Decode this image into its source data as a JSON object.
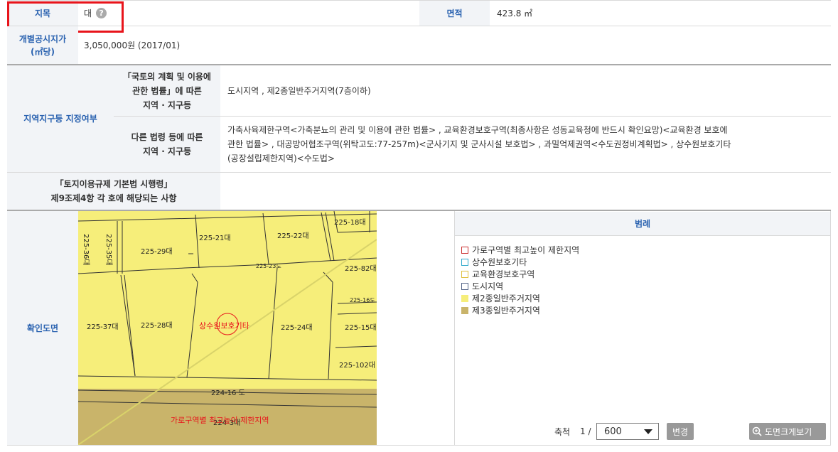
{
  "rows": {
    "jimok": {
      "label": "지목",
      "value": "대"
    },
    "area": {
      "label": "면적",
      "value": "423.8 ㎡"
    },
    "price": {
      "label_line1": "개별공시지가",
      "label_line2": "(㎡당)",
      "value": "3,050,000원 (2017/01)"
    },
    "zone": {
      "label": "지역지구등 지정여부",
      "national": {
        "label_line1": "「국토의 계획 및 이용에",
        "label_line2": "관한 법률」에 따른",
        "label_line3": "지역 · 지구등",
        "value": "도시지역 , 제2종일반주거지역(7층이하)"
      },
      "other": {
        "label_line1": "다른 법령 등에 따른",
        "label_line2": "지역 · 지구등",
        "value_line1": "가축사육제한구역<가축분뇨의 관리 및 이용에 관한 법률> , 교육환경보호구역(최종사항은 성동교육청에 반드시 확인요망)<교육환경 보호에",
        "value_line2": "관한 법률> , 대공방어협조구역(위탁고도:77-257m)<군사기지 및 군사시설 보호법> , 과밀억제권역<수도권정비계획법> , 상수원보호기타",
        "value_line3": "(공장설립제한지역)<수도법>"
      }
    },
    "enforce": {
      "label_line1": "「토지이용규제 기본법 시행령」",
      "label_line2": "제9조제4항 각 호에 해당되는 사항",
      "value": ""
    },
    "map": {
      "label": "확인도면"
    }
  },
  "map": {
    "parcels": [
      "225-18대",
      "225-21대",
      "225-22대",
      "225-29대",
      "225-36대",
      "225-35대",
      "225-23도",
      "225-82대",
      "225-16도",
      "225-37대",
      "225-28대",
      "225-24대",
      "225-15대",
      "225-102대",
      "224-16 도",
      "224-3대"
    ],
    "overlay_labels": [
      "상수원보호기타",
      "가로구역별 최고높이 제한지역"
    ]
  },
  "legend": {
    "title": "범례",
    "items": [
      {
        "label": "가로구역별 최고높이 제한지역",
        "border": "#cc3333",
        "fill": "#ffffff"
      },
      {
        "label": "상수원보호기타",
        "border": "#33aacc",
        "fill": "#ffffff"
      },
      {
        "label": "교육환경보호구역",
        "border": "#e0c040",
        "fill": "#ffffff"
      },
      {
        "label": "도시지역",
        "border": "#556688",
        "fill": "#ffffff"
      },
      {
        "label": "제2종일반주거지역",
        "border": "#f6ee7a",
        "fill": "#f6ee7a"
      },
      {
        "label": "제3종일반주거지역",
        "border": "#c9b46a",
        "fill": "#c9b46a"
      }
    ]
  },
  "scale": {
    "label": "축척",
    "prefix": "1 /",
    "value": "600",
    "change_btn": "변경",
    "enlarge_btn": "도면크게보기"
  },
  "colors": {
    "highlight": "#e8141b",
    "header_text": "#2a62b0",
    "zone2": "#f6ee7a",
    "zone3": "#c9b46a"
  }
}
